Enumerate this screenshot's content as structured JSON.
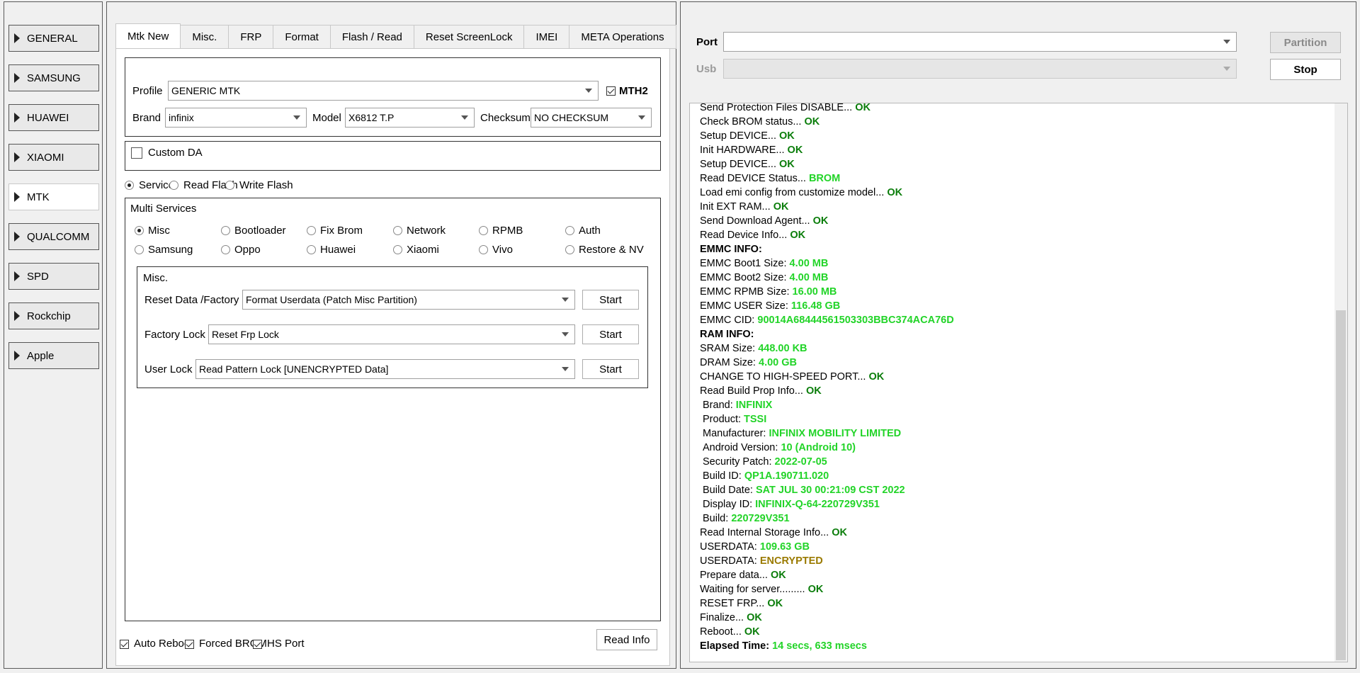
{
  "sidebar": {
    "items": [
      {
        "label": "GENERAL",
        "active": false
      },
      {
        "label": "SAMSUNG",
        "active": false
      },
      {
        "label": "HUAWEI",
        "active": false
      },
      {
        "label": "XIAOMI",
        "active": false
      },
      {
        "label": "MTK",
        "active": true
      },
      {
        "label": "QUALCOMM",
        "active": false
      },
      {
        "label": "SPD",
        "active": false
      },
      {
        "label": "Rockchip",
        "active": false
      },
      {
        "label": "Apple",
        "active": false
      }
    ]
  },
  "tabs": [
    "Mtk New",
    "Misc.",
    "FRP",
    "Format",
    "Flash / Read",
    "Reset ScreenLock",
    "IMEI",
    "META Operations"
  ],
  "active_tab": "Mtk New",
  "device": {
    "profile_label": "Profile",
    "profile_value": "GENERIC MTK",
    "mth2_label": "MTH2",
    "mth2_checked": true,
    "brand_label": "Brand",
    "brand_value": "infinix",
    "model_label": "Model",
    "model_value": "X6812 T.P",
    "checksum_label": "Checksum",
    "checksum_value": "NO CHECKSUM"
  },
  "custom_da": {
    "label": "Custom DA",
    "checked": false
  },
  "modes": [
    {
      "label": "Service",
      "checked": true
    },
    {
      "label": "Read Flash",
      "checked": false
    },
    {
      "label": "Write Flash",
      "checked": false
    }
  ],
  "multi": {
    "title": "Multi Services",
    "options": [
      {
        "label": "Misc",
        "checked": true
      },
      {
        "label": "Bootloader",
        "checked": false
      },
      {
        "label": "Fix Brom",
        "checked": false
      },
      {
        "label": "Network",
        "checked": false
      },
      {
        "label": "RPMB",
        "checked": false
      },
      {
        "label": "Auth",
        "checked": false
      },
      {
        "label": "Samsung",
        "checked": false
      },
      {
        "label": "Oppo",
        "checked": false
      },
      {
        "label": "Huawei",
        "checked": false
      },
      {
        "label": "Xiaomi",
        "checked": false
      },
      {
        "label": "Vivo",
        "checked": false
      },
      {
        "label": "Restore & NV",
        "checked": false
      }
    ]
  },
  "misc": {
    "title": "Misc.",
    "rows": [
      {
        "label": "Reset Data /Factory",
        "value": "Format Userdata (Patch Misc Partition)",
        "button": "Start"
      },
      {
        "label": "Factory Lock",
        "value": "Reset Frp Lock",
        "button": "Start"
      },
      {
        "label": "User Lock",
        "value": "Read Pattern Lock [UNENCRYPTED Data]",
        "button": "Start"
      }
    ]
  },
  "bottom": {
    "auto_reboot": {
      "label": "Auto Reboot",
      "checked": true
    },
    "forced_brom": {
      "label": "Forced BROM",
      "checked": true
    },
    "hs_port": {
      "label": "HS Port",
      "checked": true
    },
    "read_info": "Read Info"
  },
  "connection": {
    "port_label": "Port",
    "port_value": "",
    "usb_label": "Usb",
    "usb_value": "",
    "partition_button": "Partition",
    "stop_button": "Stop"
  },
  "log": [
    {
      "text": "Send Protection Files DISABLE...",
      "status": "OK",
      "color": "ok",
      "indent": false,
      "bold_text": false
    },
    {
      "text": "Check BROM status...",
      "status": "OK",
      "color": "ok",
      "indent": false,
      "bold_text": false
    },
    {
      "text": "Setup DEVICE...",
      "status": "OK",
      "color": "ok",
      "indent": false,
      "bold_text": false
    },
    {
      "text": "Init HARDWARE...",
      "status": "OK",
      "color": "ok",
      "indent": false,
      "bold_text": false
    },
    {
      "text": "Setup DEVICE...",
      "status": "OK",
      "color": "ok",
      "indent": false,
      "bold_text": false
    },
    {
      "text": "Read DEVICE Status...",
      "status": "BROM",
      "color": "lime",
      "indent": false,
      "bold_text": false
    },
    {
      "text": "Load emi config from customize model...",
      "status": "OK",
      "color": "ok",
      "indent": false,
      "bold_text": false
    },
    {
      "text": "Init EXT RAM...",
      "status": "OK",
      "color": "ok",
      "indent": false,
      "bold_text": false
    },
    {
      "text": "Send Download Agent...",
      "status": "OK",
      "color": "ok",
      "indent": false,
      "bold_text": false
    },
    {
      "text": "Read Device Info...",
      "status": "OK",
      "color": "ok",
      "indent": false,
      "bold_text": false
    },
    {
      "text": "EMMC INFO:",
      "status": "",
      "color": "ok",
      "indent": false,
      "bold_text": true
    },
    {
      "text": "EMMC Boot1 Size:",
      "status": "4.00 MB",
      "color": "lime",
      "indent": false,
      "bold_text": false
    },
    {
      "text": "EMMC Boot2 Size:",
      "status": "4.00 MB",
      "color": "lime",
      "indent": false,
      "bold_text": false
    },
    {
      "text": "EMMC RPMB Size:",
      "status": "16.00 MB",
      "color": "lime",
      "indent": false,
      "bold_text": false
    },
    {
      "text": "EMMC USER Size:",
      "status": "116.48 GB",
      "color": "lime",
      "indent": false,
      "bold_text": false
    },
    {
      "text": "EMMC CID:",
      "status": "90014A68444561503303BBC374ACA76D",
      "color": "lime",
      "indent": false,
      "bold_text": false
    },
    {
      "text": "RAM INFO:",
      "status": "",
      "color": "ok",
      "indent": false,
      "bold_text": true
    },
    {
      "text": "SRAM Size:",
      "status": "448.00 KB",
      "color": "lime",
      "indent": false,
      "bold_text": false
    },
    {
      "text": "DRAM Size:",
      "status": "4.00 GB",
      "color": "lime",
      "indent": false,
      "bold_text": false
    },
    {
      "text": "CHANGE TO HIGH-SPEED PORT...",
      "status": "OK",
      "color": "ok",
      "indent": false,
      "bold_text": false
    },
    {
      "text": "Read Build Prop Info...",
      "status": "OK",
      "color": "ok",
      "indent": false,
      "bold_text": false
    },
    {
      "text": "Brand:",
      "status": "INFINIX",
      "color": "lime",
      "indent": true,
      "bold_text": false
    },
    {
      "text": "Product:",
      "status": "TSSI",
      "color": "lime",
      "indent": true,
      "bold_text": false
    },
    {
      "text": "Manufacturer:",
      "status": "INFINIX MOBILITY LIMITED",
      "color": "lime",
      "indent": true,
      "bold_text": false
    },
    {
      "text": "Android Version:",
      "status": "10 (Android 10)",
      "color": "lime",
      "indent": true,
      "bold_text": false
    },
    {
      "text": "Security Patch:",
      "status": "2022-07-05",
      "color": "lime",
      "indent": true,
      "bold_text": false
    },
    {
      "text": "Build ID:",
      "status": "QP1A.190711.020",
      "color": "lime",
      "indent": true,
      "bold_text": false
    },
    {
      "text": "Build Date:",
      "status": "SAT JUL 30 00:21:09 CST 2022",
      "color": "lime",
      "indent": true,
      "bold_text": false
    },
    {
      "text": "Display ID:",
      "status": "INFINIX-Q-64-220729V351",
      "color": "lime",
      "indent": true,
      "bold_text": false
    },
    {
      "text": "Build:",
      "status": "220729V351",
      "color": "lime",
      "indent": true,
      "bold_text": false
    },
    {
      "text": "Read Internal Storage Info...",
      "status": "OK",
      "color": "ok",
      "indent": false,
      "bold_text": false
    },
    {
      "text": "USERDATA:",
      "status": "109.63 GB",
      "color": "lime",
      "indent": false,
      "bold_text": false
    },
    {
      "text": "USERDATA:",
      "status": "ENCRYPTED",
      "color": "olive",
      "indent": false,
      "bold_text": false
    },
    {
      "text": "Prepare data...",
      "status": "OK",
      "color": "ok",
      "indent": false,
      "bold_text": false
    },
    {
      "text": "Waiting for server.........",
      "status": "OK",
      "color": "ok",
      "indent": false,
      "bold_text": false
    },
    {
      "text": "RESET FRP...",
      "status": "OK",
      "color": "ok",
      "indent": false,
      "bold_text": false
    },
    {
      "text": "Finalize...",
      "status": "OK",
      "color": "ok",
      "indent": false,
      "bold_text": false
    },
    {
      "text": "Reboot...",
      "status": "OK",
      "color": "ok",
      "indent": false,
      "bold_text": false
    },
    {
      "text": "Elapsed Time:",
      "status": "14 secs, 633 msecs",
      "color": "lime",
      "indent": false,
      "bold_text": true
    }
  ]
}
